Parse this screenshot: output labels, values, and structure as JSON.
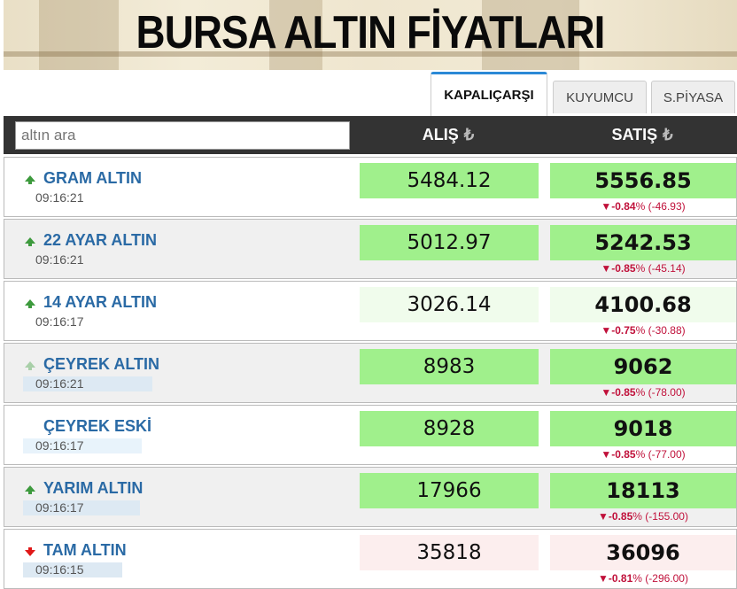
{
  "banner": {
    "title": "BURSA ALTIN FİYATLARI"
  },
  "tabs": [
    {
      "label": "KAPALIÇARŞI",
      "active": true
    },
    {
      "label": "KUYUMCU",
      "active": false
    },
    {
      "label": "S.PİYASA",
      "active": false
    }
  ],
  "search": {
    "placeholder": "altın ara",
    "value": ""
  },
  "columns": {
    "buy": "ALIŞ",
    "sell": "SATIŞ",
    "currency": "₺"
  },
  "colors": {
    "header_bg": "#333333",
    "link_blue": "#2a6aa5",
    "tab_accent": "#2b89d6",
    "box_green": "#a0f08c",
    "box_green_light": "#f0fcec",
    "box_red_light": "#fceeee",
    "arrow_up": "#3d9a3d",
    "arrow_up_light": "#a8cfa8",
    "arrow_down": "#e01818",
    "change_red": "#c0103a"
  },
  "rows": [
    {
      "name": "GRAM ALTIN",
      "time": "09:16:21",
      "trend": "up",
      "buy": "5484.12",
      "sell": "5556.85",
      "change_pct": "-0.84",
      "change_abs": "(-46.93)",
      "box_style": "green"
    },
    {
      "name": "22 AYAR ALTIN",
      "time": "09:16:21",
      "trend": "up",
      "buy": "5012.97",
      "sell": "5242.53",
      "change_pct": "-0.85",
      "change_abs": "(-45.14)",
      "box_style": "green"
    },
    {
      "name": "14 AYAR ALTIN",
      "time": "09:16:17",
      "trend": "up",
      "buy": "3026.14",
      "sell": "4100.68",
      "change_pct": "-0.75",
      "change_abs": "(-30.88)",
      "box_style": "light-green"
    },
    {
      "name": "ÇEYREK ALTIN",
      "time": "09:16:21",
      "trend": "up-light",
      "buy": "8983",
      "sell": "9062",
      "change_pct": "-0.85",
      "change_abs": "(-78.00)",
      "box_style": "green"
    },
    {
      "name": "ÇEYREK ESKİ",
      "time": "09:16:17",
      "trend": "none",
      "buy": "8928",
      "sell": "9018",
      "change_pct": "-0.85",
      "change_abs": "(-77.00)",
      "box_style": "green"
    },
    {
      "name": "YARIM ALTIN",
      "time": "09:16:17",
      "trend": "up",
      "buy": "17966",
      "sell": "18113",
      "change_pct": "-0.85",
      "change_abs": "(-155.00)",
      "box_style": "green"
    },
    {
      "name": "TAM ALTIN",
      "time": "09:16:15",
      "trend": "down",
      "buy": "35818",
      "sell": "36096",
      "change_pct": "-0.81",
      "change_abs": "(-296.00)",
      "box_style": "light-red"
    }
  ]
}
